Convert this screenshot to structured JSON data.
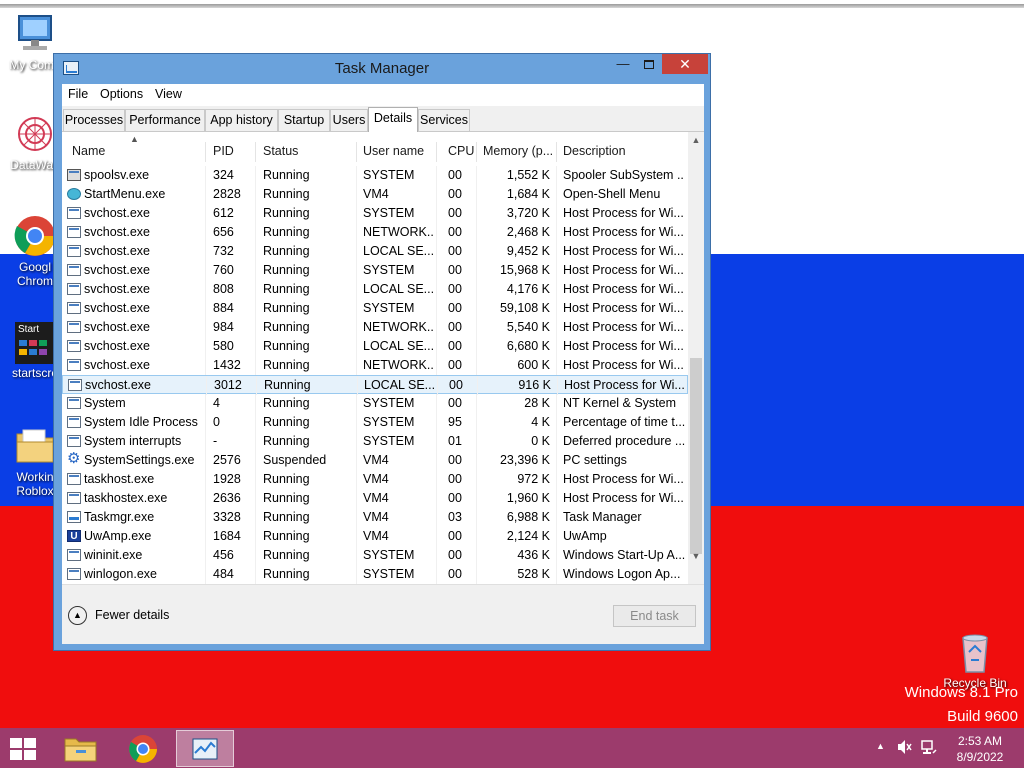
{
  "desktop": {
    "icons": [
      {
        "label": "My Comp"
      },
      {
        "label": "DataWag"
      },
      {
        "label": "Googl",
        "label2": "Chrom"
      },
      {
        "label": "startscre",
        "badge": "Start"
      },
      {
        "label": "Workin",
        "label2": "Roblox"
      }
    ],
    "recycle_bin": "Recycle Bin",
    "watermark_line1": "Windows 8.1 Pro",
    "watermark_line2": "Build 9600"
  },
  "window": {
    "title": "Task Manager",
    "minimize": "—",
    "close": "✕"
  },
  "menu": [
    "File",
    "Options",
    "View"
  ],
  "tabs": [
    "Processes",
    "Performance",
    "App history",
    "Startup",
    "Users",
    "Details",
    "Services"
  ],
  "active_tab": "Details",
  "columns": [
    "Name",
    "PID",
    "Status",
    "User name",
    "CPU",
    "Memory (p...",
    "Description"
  ],
  "rows": [
    {
      "icon": "printer",
      "name": "spoolsv.exe",
      "pid": "324",
      "status": "Running",
      "user": "SYSTEM",
      "cpu": "00",
      "mem": "1,552 K",
      "desc": "Spooler SubSystem ..."
    },
    {
      "icon": "round",
      "name": "StartMenu.exe",
      "pid": "2828",
      "status": "Running",
      "user": "VM4",
      "cpu": "00",
      "mem": "1,684 K",
      "desc": "Open-Shell Menu"
    },
    {
      "icon": "window",
      "name": "svchost.exe",
      "pid": "612",
      "status": "Running",
      "user": "SYSTEM",
      "cpu": "00",
      "mem": "3,720 K",
      "desc": "Host Process for Wi..."
    },
    {
      "icon": "window",
      "name": "svchost.exe",
      "pid": "656",
      "status": "Running",
      "user": "NETWORK...",
      "cpu": "00",
      "mem": "2,468 K",
      "desc": "Host Process for Wi..."
    },
    {
      "icon": "window",
      "name": "svchost.exe",
      "pid": "732",
      "status": "Running",
      "user": "LOCAL SE...",
      "cpu": "00",
      "mem": "9,452 K",
      "desc": "Host Process for Wi..."
    },
    {
      "icon": "window",
      "name": "svchost.exe",
      "pid": "760",
      "status": "Running",
      "user": "SYSTEM",
      "cpu": "00",
      "mem": "15,968 K",
      "desc": "Host Process for Wi..."
    },
    {
      "icon": "window",
      "name": "svchost.exe",
      "pid": "808",
      "status": "Running",
      "user": "LOCAL SE...",
      "cpu": "00",
      "mem": "4,176 K",
      "desc": "Host Process for Wi..."
    },
    {
      "icon": "window",
      "name": "svchost.exe",
      "pid": "884",
      "status": "Running",
      "user": "SYSTEM",
      "cpu": "00",
      "mem": "59,108 K",
      "desc": "Host Process for Wi..."
    },
    {
      "icon": "window",
      "name": "svchost.exe",
      "pid": "984",
      "status": "Running",
      "user": "NETWORK...",
      "cpu": "00",
      "mem": "5,540 K",
      "desc": "Host Process for Wi..."
    },
    {
      "icon": "window",
      "name": "svchost.exe",
      "pid": "580",
      "status": "Running",
      "user": "LOCAL SE...",
      "cpu": "00",
      "mem": "6,680 K",
      "desc": "Host Process for Wi..."
    },
    {
      "icon": "window",
      "name": "svchost.exe",
      "pid": "1432",
      "status": "Running",
      "user": "NETWORK...",
      "cpu": "00",
      "mem": "600 K",
      "desc": "Host Process for Wi..."
    },
    {
      "icon": "window",
      "name": "svchost.exe",
      "pid": "3012",
      "status": "Running",
      "user": "LOCAL SE...",
      "cpu": "00",
      "mem": "916 K",
      "desc": "Host Process for Wi...",
      "selected": true
    },
    {
      "icon": "window",
      "name": "System",
      "pid": "4",
      "status": "Running",
      "user": "SYSTEM",
      "cpu": "00",
      "mem": "28 K",
      "desc": "NT Kernel & System"
    },
    {
      "icon": "window",
      "name": "System Idle Process",
      "pid": "0",
      "status": "Running",
      "user": "SYSTEM",
      "cpu": "95",
      "mem": "4 K",
      "desc": "Percentage of time t..."
    },
    {
      "icon": "window",
      "name": "System interrupts",
      "pid": "-",
      "status": "Running",
      "user": "SYSTEM",
      "cpu": "01",
      "mem": "0 K",
      "desc": "Deferred procedure ..."
    },
    {
      "icon": "gear",
      "name": "SystemSettings.exe",
      "pid": "2576",
      "status": "Suspended",
      "user": "VM4",
      "cpu": "00",
      "mem": "23,396 K",
      "desc": "PC settings"
    },
    {
      "icon": "window",
      "name": "taskhost.exe",
      "pid": "1928",
      "status": "Running",
      "user": "VM4",
      "cpu": "00",
      "mem": "972 K",
      "desc": "Host Process for Wi..."
    },
    {
      "icon": "window",
      "name": "taskhostex.exe",
      "pid": "2636",
      "status": "Running",
      "user": "VM4",
      "cpu": "00",
      "mem": "1,960 K",
      "desc": "Host Process for Wi..."
    },
    {
      "icon": "taskmgr",
      "name": "Taskmgr.exe",
      "pid": "3328",
      "status": "Running",
      "user": "VM4",
      "cpu": "03",
      "mem": "6,988 K",
      "desc": "Task Manager"
    },
    {
      "icon": "uw",
      "name": "UwAmp.exe",
      "pid": "1684",
      "status": "Running",
      "user": "VM4",
      "cpu": "00",
      "mem": "2,124 K",
      "desc": "UwAmp"
    },
    {
      "icon": "window",
      "name": "wininit.exe",
      "pid": "456",
      "status": "Running",
      "user": "SYSTEM",
      "cpu": "00",
      "mem": "436 K",
      "desc": "Windows Start-Up A..."
    },
    {
      "icon": "window",
      "name": "winlogon.exe",
      "pid": "484",
      "status": "Running",
      "user": "SYSTEM",
      "cpu": "00",
      "mem": "528 K",
      "desc": "Windows Logon Ap..."
    }
  ],
  "footer": {
    "fewer_details": "Fewer details",
    "end_task": "End task"
  },
  "taskbar": {
    "time": "2:53 AM",
    "date": "8/9/2022"
  },
  "colors": {
    "flag_white": "#ffffff",
    "flag_blue": "#0a3ee6",
    "flag_red": "#f00d0d",
    "taskbar": "#9c3b6c",
    "window_frame": "#6aa2dc",
    "close_button": "#c7423a",
    "selection": "#e6f2fb"
  }
}
